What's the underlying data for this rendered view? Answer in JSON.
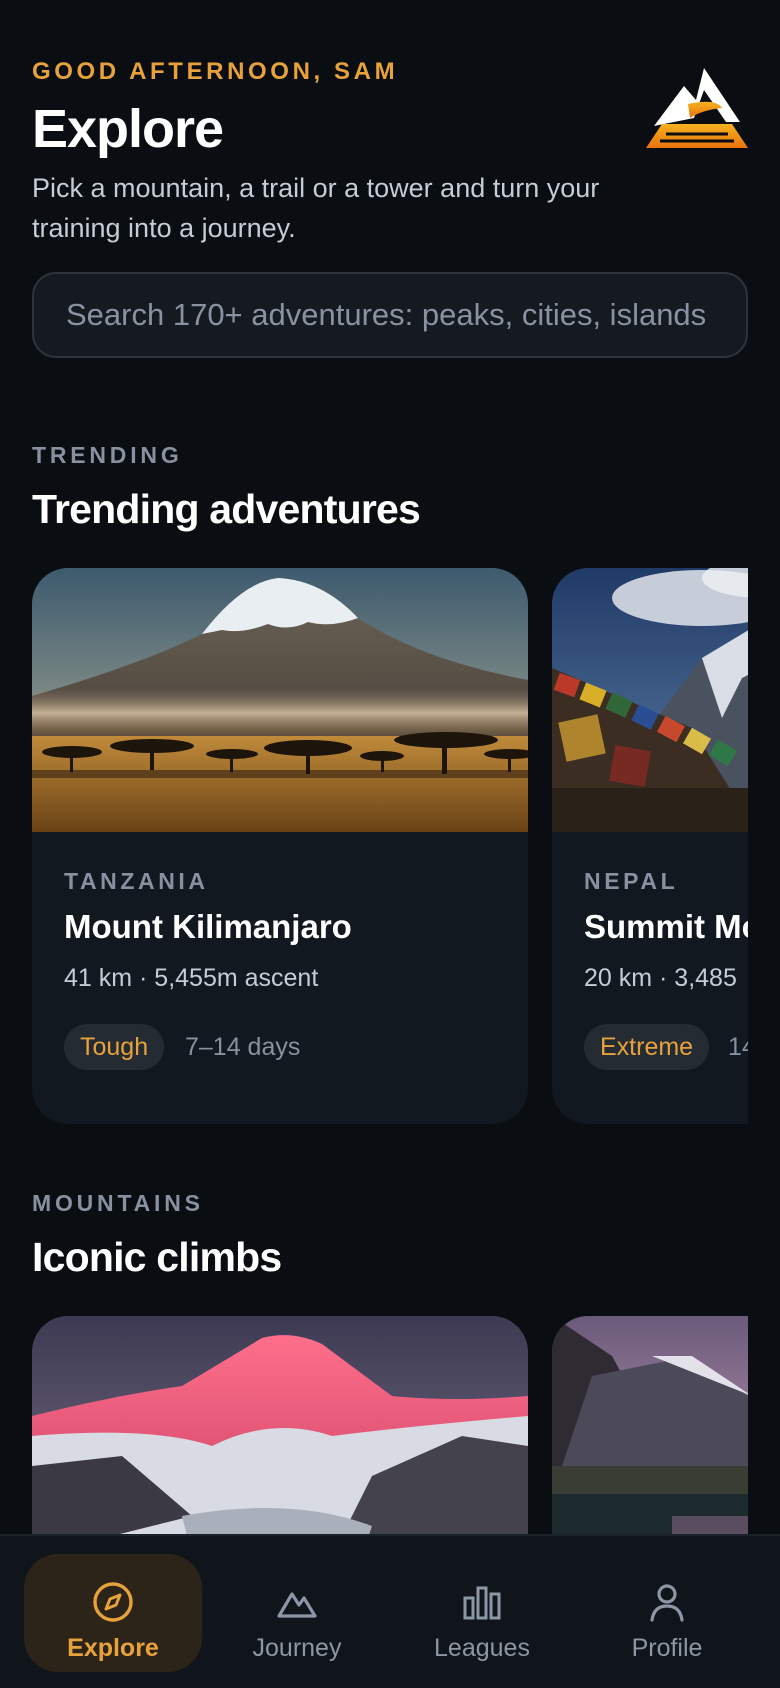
{
  "header": {
    "greeting": "GOOD AFTERNOON, SAM",
    "title": "Explore",
    "subtitle": "Pick a mountain, a trail or a tower and turn your training into a journey.",
    "logo_icon": "mountain-logo-icon"
  },
  "search": {
    "placeholder": "Search 170+ adventures: peaks, cities, islands",
    "value": ""
  },
  "trending": {
    "eyebrow": "TRENDING",
    "title": "Trending adventures",
    "cards": [
      {
        "country": "TANZANIA",
        "name": "Mount Kilimanjaro",
        "stats": "41 km · 5,455m ascent",
        "difficulty": "Tough",
        "duration": "7–14 days"
      },
      {
        "country": "NEPAL",
        "name": "Summit Mo",
        "stats": "20 km · 3,485",
        "difficulty": "Extreme",
        "duration": "14"
      }
    ]
  },
  "mountains": {
    "eyebrow": "MOUNTAINS",
    "title": "Iconic climbs"
  },
  "tabbar": {
    "items": [
      {
        "label": "Explore",
        "icon": "compass-icon",
        "active": true
      },
      {
        "label": "Journey",
        "icon": "mountain-icon",
        "active": false
      },
      {
        "label": "Leagues",
        "icon": "bar-chart-icon",
        "active": false
      },
      {
        "label": "Profile",
        "icon": "person-icon",
        "active": false
      }
    ]
  },
  "colors": {
    "accent": "#e8a23b",
    "background": "#0a0d11",
    "card": "#121820",
    "muted": "#8791a0"
  }
}
